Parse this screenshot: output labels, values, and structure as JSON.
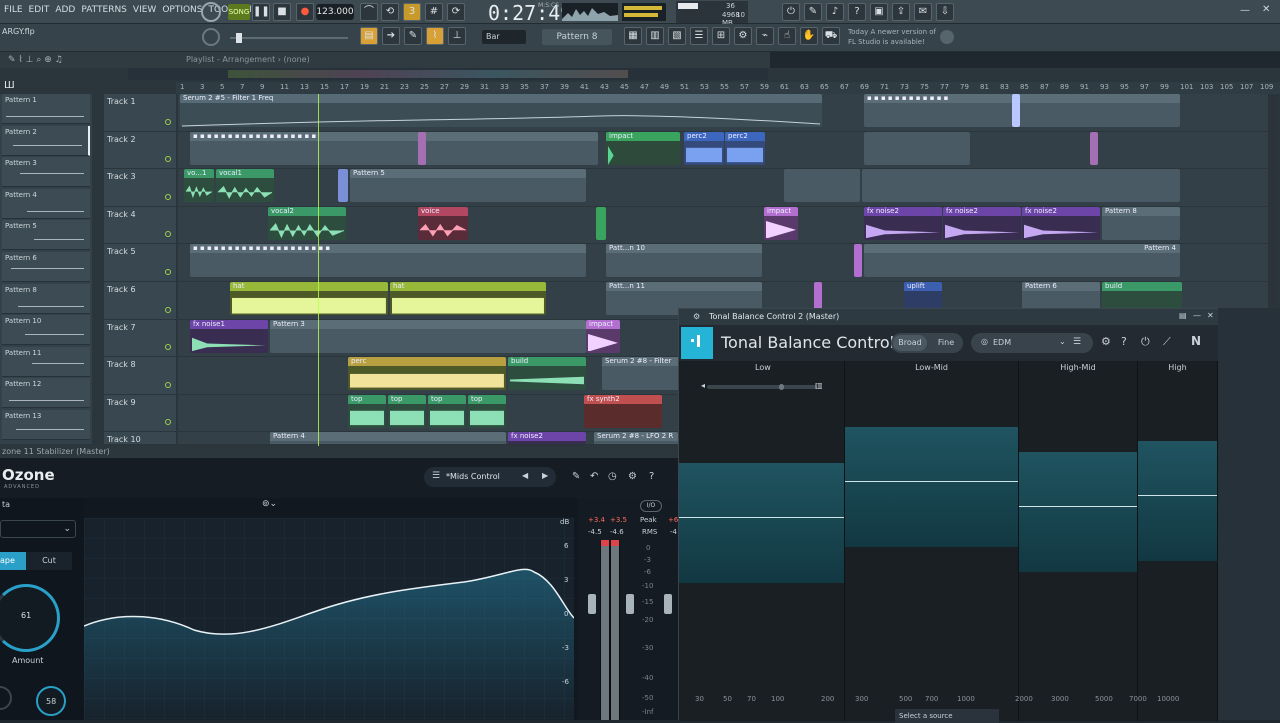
{
  "menus": [
    "FILE",
    "EDIT",
    "ADD",
    "PATTERNS",
    "VIEW",
    "OPTIONS",
    "TOOLS",
    "HELP"
  ],
  "transport": {
    "mode": "SONG",
    "tempo": "123.000",
    "time": "0:27:49",
    "time_unit": "M:S:CS",
    "memory": "4968 MB",
    "cpu": "36",
    "voices": "10"
  },
  "project": {
    "file": "ARGY.flp",
    "snap": "Bar",
    "pattern": "Pattern 8",
    "news_line1": "Today  A newer version of",
    "news_line2": "FL Studio is available!"
  },
  "playlist": {
    "breadcrumb": "Playlist - Arrangement › (none)",
    "ruler": [
      "1",
      "3",
      "5",
      "7",
      "9",
      "11",
      "13",
      "15",
      "17",
      "19",
      "21",
      "23",
      "25",
      "27",
      "29",
      "31",
      "33",
      "35",
      "37",
      "39",
      "41",
      "43",
      "45",
      "47",
      "49",
      "51",
      "53",
      "55",
      "57",
      "59",
      "61",
      "63",
      "65",
      "67",
      "69",
      "71",
      "73",
      "75",
      "77",
      "79",
      "81",
      "83",
      "85",
      "87",
      "89",
      "91",
      "93",
      "95",
      "97",
      "99",
      "101",
      "103",
      "105",
      "107",
      "109"
    ],
    "patterns": [
      "Pattern 1",
      "Pattern 2",
      "Pattern 3",
      "Pattern 4",
      "Pattern 5",
      "Pattern 6",
      "Pattern 8",
      "Pattern 10",
      "Pattern 11",
      "Pattern 12",
      "Pattern 13"
    ],
    "tracks": [
      "Track 1",
      "Track 2",
      "Track 3",
      "Track 4",
      "Track 5",
      "Track 6",
      "Track 7",
      "Track 8",
      "Track 9",
      "Track 10"
    ],
    "clip_labels": {
      "t1": "Serum 2 #5 - Filter 1 Freq",
      "t2a": "impact",
      "t2b": "perc2",
      "t2c": "perc2",
      "t3a": "vo...1",
      "t3b": "vocal1",
      "t3c": "Pattern 5",
      "t4a": "vocal2",
      "t4b": "voice",
      "t4c": "impact",
      "t4d": "fx noise2",
      "t4e": "fx noise2",
      "t4f": "fx noise2",
      "t4g": "Pattern 8",
      "t5a": "Patt...n 10",
      "t5b": "Pattern 4",
      "t6a": "hat",
      "t6b": "hat",
      "t6c": "Patt...n 11",
      "t6d": "uplift",
      "t6e": "Pattern 6",
      "t6f": "build",
      "t7a": "fx noise1",
      "t7b": "Pattern 3",
      "t7c": "impact",
      "t8a": "perc",
      "t8b": "build",
      "t8c": "Serum 2 #8 - Filter",
      "t9a": "top",
      "t9b": "top",
      "t9c": "top",
      "t9d": "top",
      "t9e": "fx synth2",
      "t10a": "Pattern 4",
      "t10b": "fx noise2",
      "t10c": "Serum 2 #8 - LFO 2 R"
    }
  },
  "ozone": {
    "header": "zone 11 Stabilizer (Master)",
    "logo": "Ozone",
    "logo_sub": "ADVANCED",
    "preset": "*Mids Control",
    "side_label": "ta",
    "tab_shape": "ape",
    "tab_cut": "Cut",
    "amount_value": "61",
    "amount_label": "Amount",
    "knob2_value": "58",
    "db_scale": [
      "dB",
      "6",
      "3",
      "0",
      "-3",
      "-6"
    ],
    "meter_peak_l": "+3.4",
    "meter_peak_r": "+3.5",
    "meter_peak_label": "Peak",
    "meter_peak_extra": "+6",
    "meter_rms_l": "-4.5",
    "meter_rms_r": "-4.6",
    "meter_rms_label": "RMS",
    "meter_rms_extra": "-4",
    "meter_scale": [
      "0",
      "-3",
      "-6",
      "-10",
      "-15",
      "-20",
      "-30",
      "-40",
      "-50",
      "-Inf"
    ],
    "io": "I/O"
  },
  "tbc": {
    "window_title": "Tonal Balance Control 2 (Master)",
    "title": "Tonal Balance Control",
    "view_broad": "Broad",
    "view_fine": "Fine",
    "target": "EDM",
    "bands": [
      "Low",
      "Low-Mid",
      "High-Mid",
      "High"
    ],
    "band_levels_pct": [
      45,
      35,
      42,
      39
    ],
    "freqs": [
      "30",
      "50",
      "70",
      "100",
      "200",
      "300",
      "500",
      "700",
      "1000",
      "2000",
      "3000",
      "5000",
      "7000",
      "10000"
    ],
    "source": "Select a source"
  }
}
